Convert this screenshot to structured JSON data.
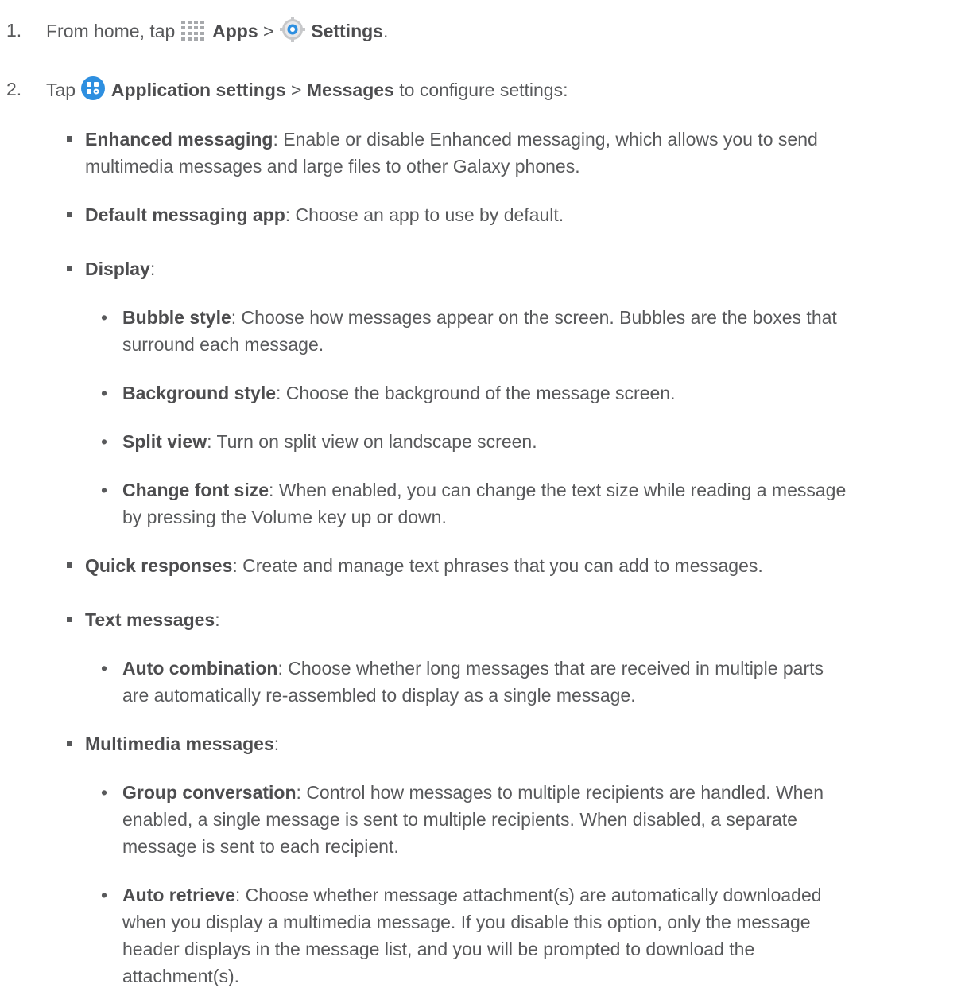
{
  "steps": [
    {
      "num": "1.",
      "pre": "From home, tap ",
      "apps": "Apps",
      "sep": " > ",
      "settings": "Settings",
      "end": "."
    },
    {
      "num": "2.",
      "pre": "Tap ",
      "app_settings": "Application settings",
      "sep": " > ",
      "messages": "Messages",
      "end": " to configure settings:"
    }
  ],
  "items": {
    "enhanced": {
      "title": "Enhanced messaging",
      "text": ": Enable or disable Enhanced messaging, which allows you to send",
      "text2": "multimedia messages and large files to other Galaxy phones."
    },
    "default_app": {
      "title": "Default messaging app",
      "text": ": Choose an app to use by default."
    },
    "display": {
      "title": "Display",
      "text": ":"
    },
    "bubble": {
      "title": "Bubble style",
      "text": ": Choose how messages appear on the screen. Bubbles are the boxes that",
      "text2": "surround each message."
    },
    "background": {
      "title": "Background style",
      "text": ": Choose the background of the message screen."
    },
    "split": {
      "title": "Split view",
      "text": ": Turn on split view on landscape screen."
    },
    "font": {
      "title": "Change font size",
      "text": ": When enabled, you can change the text size while reading a message",
      "text2": "by pressing the Volume key up or down."
    },
    "quick": {
      "title": "Quick responses",
      "text": ": Create and manage text phrases that you can add to messages."
    },
    "text_messages": {
      "title": "Text messages",
      "text": ":"
    },
    "auto_comb": {
      "title": "Auto combination",
      "text": ": Choose whether long messages that are received in multiple parts",
      "text2": "are automatically re-assembled to display as a single message."
    },
    "mms": {
      "title": "Multimedia messages",
      "text": ":"
    },
    "group": {
      "title": "Group conversation",
      "text": ": Control how messages to multiple recipients are handled. When",
      "text2": "enabled, a single message is sent to multiple recipients. When disabled, a separate",
      "text3": "message is sent to each recipient."
    },
    "auto_retrieve": {
      "title": "Auto retrieve",
      "text": ": Choose whether message attachment(s) are automatically downloaded",
      "text2": "when you display a multimedia message. If you disable this option, only the message",
      "text3": "header displays in the message list, and you will be prompted to download the",
      "text4": "attachment(s)."
    }
  },
  "icons": {
    "apps": "apps-grid-icon",
    "settings": "settings-gear-icon",
    "app_settings": "application-settings-icon"
  },
  "colors": {
    "text": "#58595b",
    "bold": "#4d4d4f",
    "icon_blue": "#2e8fe0"
  }
}
